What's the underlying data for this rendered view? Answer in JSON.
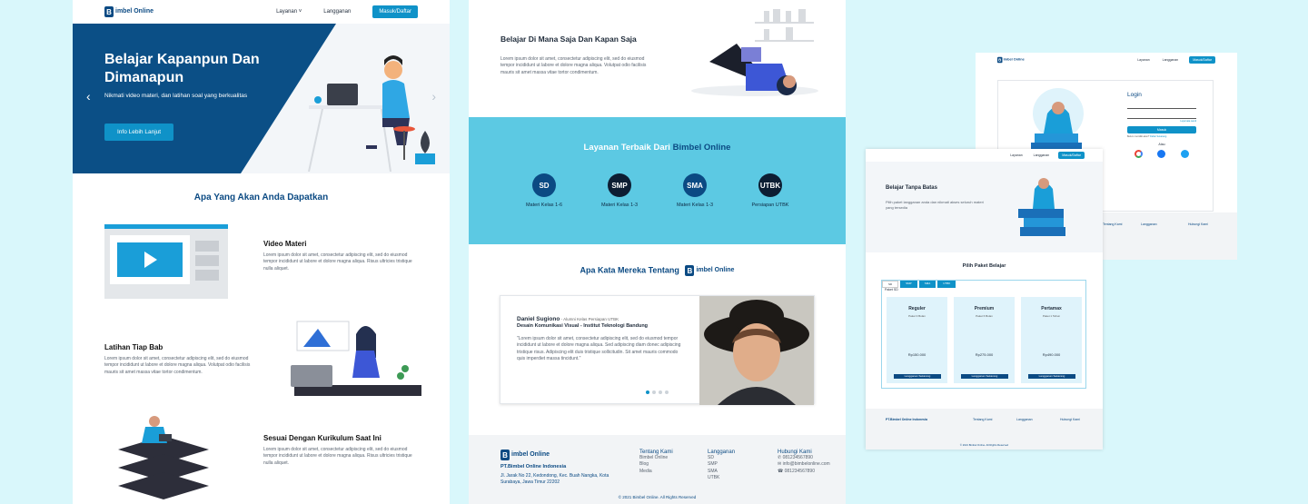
{
  "brand": {
    "logo_box": "B",
    "logo_text": "imbel Online"
  },
  "nav": {
    "layanan": "Layanan",
    "langganan": "Langganan",
    "masuk": "Masuk/Daftar"
  },
  "hero": {
    "title": "Belajar Kapanpun Dan Dimanapun",
    "subtitle": "Nikmati video materi, dan latihan soal yang berkualitas",
    "cta": "Info Lebih Lanjut"
  },
  "features": {
    "heading": "Apa Yang Akan Anda Dapatkan",
    "items": [
      {
        "title": "Video Materi",
        "text": "Lorem ipsum dolor sit amet, consectetur adipiscing elit, sed do eiusmod tempor incididunt ut labore et dolore magna aliqua. Risus ultricies tristique nulla aliquet."
      },
      {
        "title": "Latihan Tiap Bab",
        "text": "Lorem ipsum dolor sit amet, consectetur adipiscing elit, sed do eiusmod tempor incididunt ut labore et dolore magna aliqua. Volutpat odio facilisis mauris sit amet massa vitae tortor condimentum."
      },
      {
        "title": "Sesuai Dengan Kurikulum Saat Ini",
        "text": "Lorem ipsum dolor sit amet, consectetur adipiscing elit, sed do eiusmod tempor incididunt ut labore et dolore magna aliqua. Risus ultricies tristique nulla aliquet."
      }
    ]
  },
  "learn_anywhere": {
    "title": "Belajar Di Mana Saja Dan Kapan Saja",
    "text": "Lorem ipsum dolor sit amet, consectetur adipiscing elit, sed do eiusmod tempor incididunt ut labore et dolore magna aliqua. Volutpat odio facilisis mauris sit amet massa vitae tortor condimentum."
  },
  "services": {
    "title_a": "Layanan Terbaik Dari ",
    "title_b": "Bimbel Online",
    "items": [
      {
        "code": "SD",
        "label": "Materi Kelas 1-6"
      },
      {
        "code": "SMP",
        "label": "Materi Kelas 1-3"
      },
      {
        "code": "SMA",
        "label": "Materi Kelas 1-3"
      },
      {
        "code": "UTBK",
        "label": "Persiapan UTBK"
      }
    ]
  },
  "testimonial": {
    "heading": "Apa Kata Mereka Tentang",
    "name": "Daniel Sugiono",
    "role": " - Alumni Kelas Persiapan UTBK",
    "school": "Desain Komunikasi Visual - Institut Teknologi Bandung",
    "quote": "\"Lorem ipsum dolor sit amet, consectetur adipiscing elit, sed do eiusmod tempor incididunt ut labore et dolore magna aliqua. Sed adipiscing diam donec adipiscing tristique risus. Adipiscing elit duis tristique sollicitudin. Sit amet mauris commodo quis imperdiet massa tincidunt.\""
  },
  "footer": {
    "company": "PT.Bimbel Online Indonesia",
    "address": "Jl. Jarak No 22, Kedondong, Kec. Buah Nangka, Kota Surabaya, Jawa Timur 22202",
    "col1_title": "Tentang Kami",
    "col1": [
      "Bimbel Online",
      "Blog",
      "Media"
    ],
    "col2_title": "Langganan",
    "col2": [
      "SD",
      "SMP",
      "SMA",
      "UTBK"
    ],
    "col3_title": "Hubungi Kami",
    "col3": [
      "081234567890",
      "info@bimbelonline.com",
      "081234567890"
    ],
    "copyright": "© 2021 Bimbel Online. All Rights Reserved"
  },
  "login": {
    "title": "Login",
    "forgot": "Lupa kata sandi",
    "button": "Masuk",
    "register_prompt": "Belum memiliki akun?",
    "register_link": "Daftar Sekarang",
    "or": "Atau"
  },
  "unlimited": {
    "title": "Belajar Tanpa Batas",
    "text": "Pilih paket langganan anda dan nikmati akses seluruh materi yang tersedia"
  },
  "packages": {
    "heading": "Pilih Paket Belajar",
    "tabs": [
      "SD",
      "SMP",
      "SMA",
      "UTBK"
    ],
    "label": "Paket SD",
    "items": [
      {
        "name": "Reguler",
        "period": "Paket 3 Bulan",
        "price": "Rp150.000",
        "button": "Langganan Sekarang"
      },
      {
        "name": "Premium",
        "period": "Paket 6 Bulan",
        "price": "Rp275.000",
        "button": "Langganan Sekarang"
      },
      {
        "name": "Pertamax",
        "period": "Paket 1 Tahun",
        "price": "Rp490.000",
        "button": "Langganan Sekarang"
      }
    ]
  }
}
